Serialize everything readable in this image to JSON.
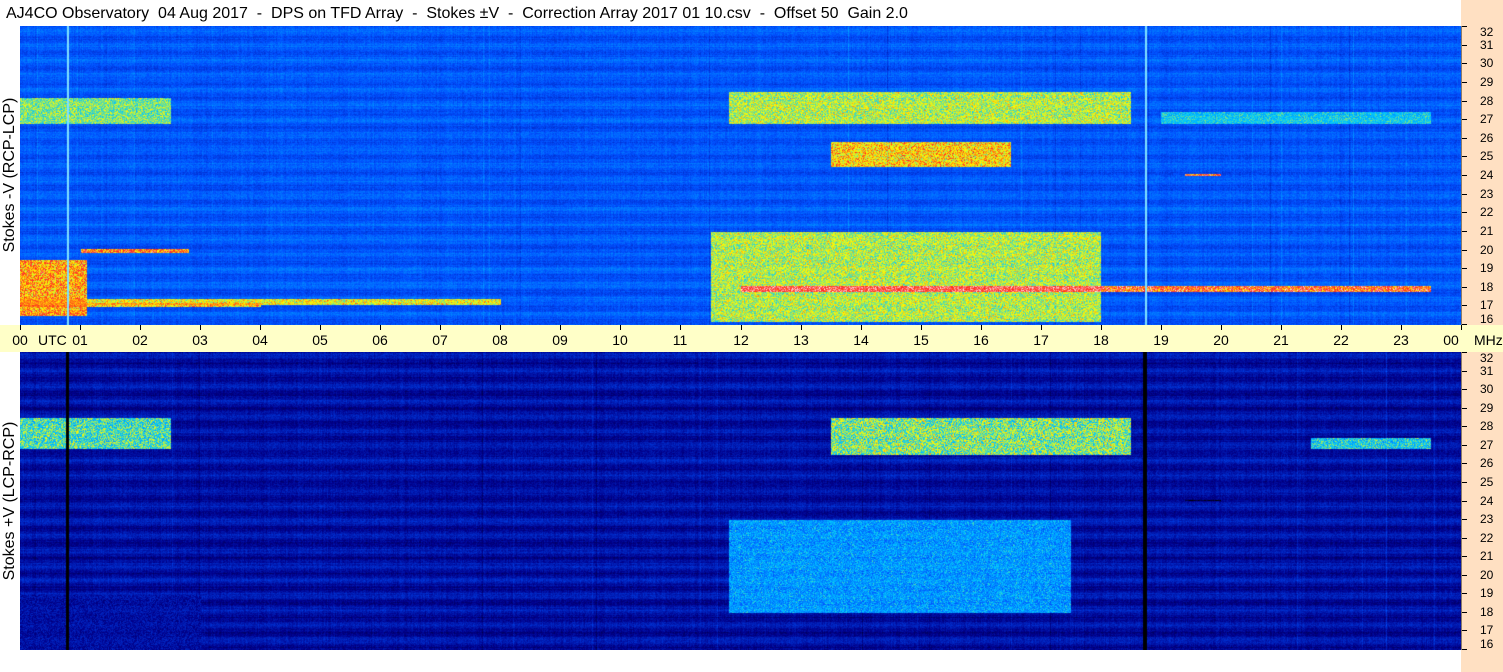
{
  "title": "AJ4CO Observatory  04 Aug 2017  -  DPS on TFD Array  -  Stokes ±V  -  Correction Array 2017 01 10.csv  -  Offset 50  Gain 2.0",
  "chart_data": [
    {
      "type": "heatmap",
      "ylabel": "Stokes -V (RCP-LCP)",
      "xlabel": "UTC",
      "x_unit": "UTC",
      "y_unit": "MHz",
      "x_ticks": [
        "00",
        "01",
        "02",
        "03",
        "04",
        "05",
        "06",
        "07",
        "08",
        "09",
        "10",
        "11",
        "12",
        "13",
        "14",
        "15",
        "16",
        "17",
        "18",
        "19",
        "20",
        "21",
        "22",
        "23",
        "00"
      ],
      "y_ticks": [
        16,
        17,
        18,
        19,
        20,
        21,
        22,
        23,
        24,
        25,
        26,
        27,
        28,
        29,
        30,
        31,
        32
      ],
      "xlim": [
        0,
        24
      ],
      "ylim": [
        16,
        32
      ],
      "colormap": [
        "#000000",
        "#00008b",
        "#0050ff",
        "#00c8ff",
        "#ffff00",
        "#ff2020",
        "#ffffff"
      ],
      "features": [
        {
          "x": [
            0.0,
            1.1
          ],
          "y": [
            16.5,
            19.5
          ],
          "level": 0.85
        },
        {
          "x": [
            0.0,
            4.0
          ],
          "y": [
            17.0,
            17.2
          ],
          "level": 0.8
        },
        {
          "x": [
            0.0,
            8.0
          ],
          "y": [
            17.1,
            17.4
          ],
          "level": 0.75
        },
        {
          "x": [
            1.0,
            2.8
          ],
          "y": [
            19.9,
            20.1
          ],
          "level": 0.9
        },
        {
          "x": [
            0.0,
            2.5
          ],
          "y": [
            26.8,
            28.2
          ],
          "level": 0.65
        },
        {
          "x": [
            11.5,
            18.0
          ],
          "y": [
            16.2,
            21.0
          ],
          "level": 0.7
        },
        {
          "x": [
            12.0,
            23.5
          ],
          "y": [
            17.8,
            18.1
          ],
          "level": 0.95
        },
        {
          "x": [
            13.5,
            16.5
          ],
          "y": [
            24.5,
            25.8
          ],
          "level": 0.8
        },
        {
          "x": [
            11.8,
            18.5
          ],
          "y": [
            26.8,
            28.5
          ],
          "level": 0.7
        },
        {
          "x": [
            19.0,
            23.5
          ],
          "y": [
            26.8,
            27.4
          ],
          "level": 0.55
        },
        {
          "x": [
            19.4,
            20.0
          ],
          "y": [
            24.0,
            24.1
          ],
          "level": 0.95
        }
      ]
    },
    {
      "type": "heatmap",
      "ylabel": "Stokes +V (LCP-RCP)",
      "xlabel": "UTC",
      "x_unit": "UTC",
      "y_unit": "MHz",
      "x_ticks": [
        "00",
        "01",
        "02",
        "03",
        "04",
        "05",
        "06",
        "07",
        "08",
        "09",
        "10",
        "11",
        "12",
        "13",
        "14",
        "15",
        "16",
        "17",
        "18",
        "19",
        "20",
        "21",
        "22",
        "23",
        "00"
      ],
      "y_ticks": [
        16,
        17,
        18,
        19,
        20,
        21,
        22,
        23,
        24,
        25,
        26,
        27,
        28,
        29,
        30,
        31,
        32
      ],
      "xlim": [
        0,
        24
      ],
      "ylim": [
        16,
        32
      ],
      "colormap": [
        "#000000",
        "#00008b",
        "#0050ff",
        "#00c8ff",
        "#ffff00",
        "#ff2020",
        "#ffffff"
      ],
      "features": [
        {
          "x": [
            0.0,
            2.5
          ],
          "y": [
            26.8,
            28.5
          ],
          "level": 0.65
        },
        {
          "x": [
            13.5,
            18.5
          ],
          "y": [
            26.5,
            28.5
          ],
          "level": 0.7
        },
        {
          "x": [
            21.5,
            23.5
          ],
          "y": [
            26.8,
            27.4
          ],
          "level": 0.6
        },
        {
          "x": [
            11.8,
            17.5
          ],
          "y": [
            18.0,
            23.0
          ],
          "level": 0.5
        },
        {
          "x": [
            0.0,
            3.0
          ],
          "y": [
            16.0,
            19.0
          ],
          "level": 0.2
        },
        {
          "x": [
            19.4,
            20.0
          ],
          "y": [
            24.0,
            24.1
          ],
          "level": 0.0
        }
      ]
    }
  ]
}
